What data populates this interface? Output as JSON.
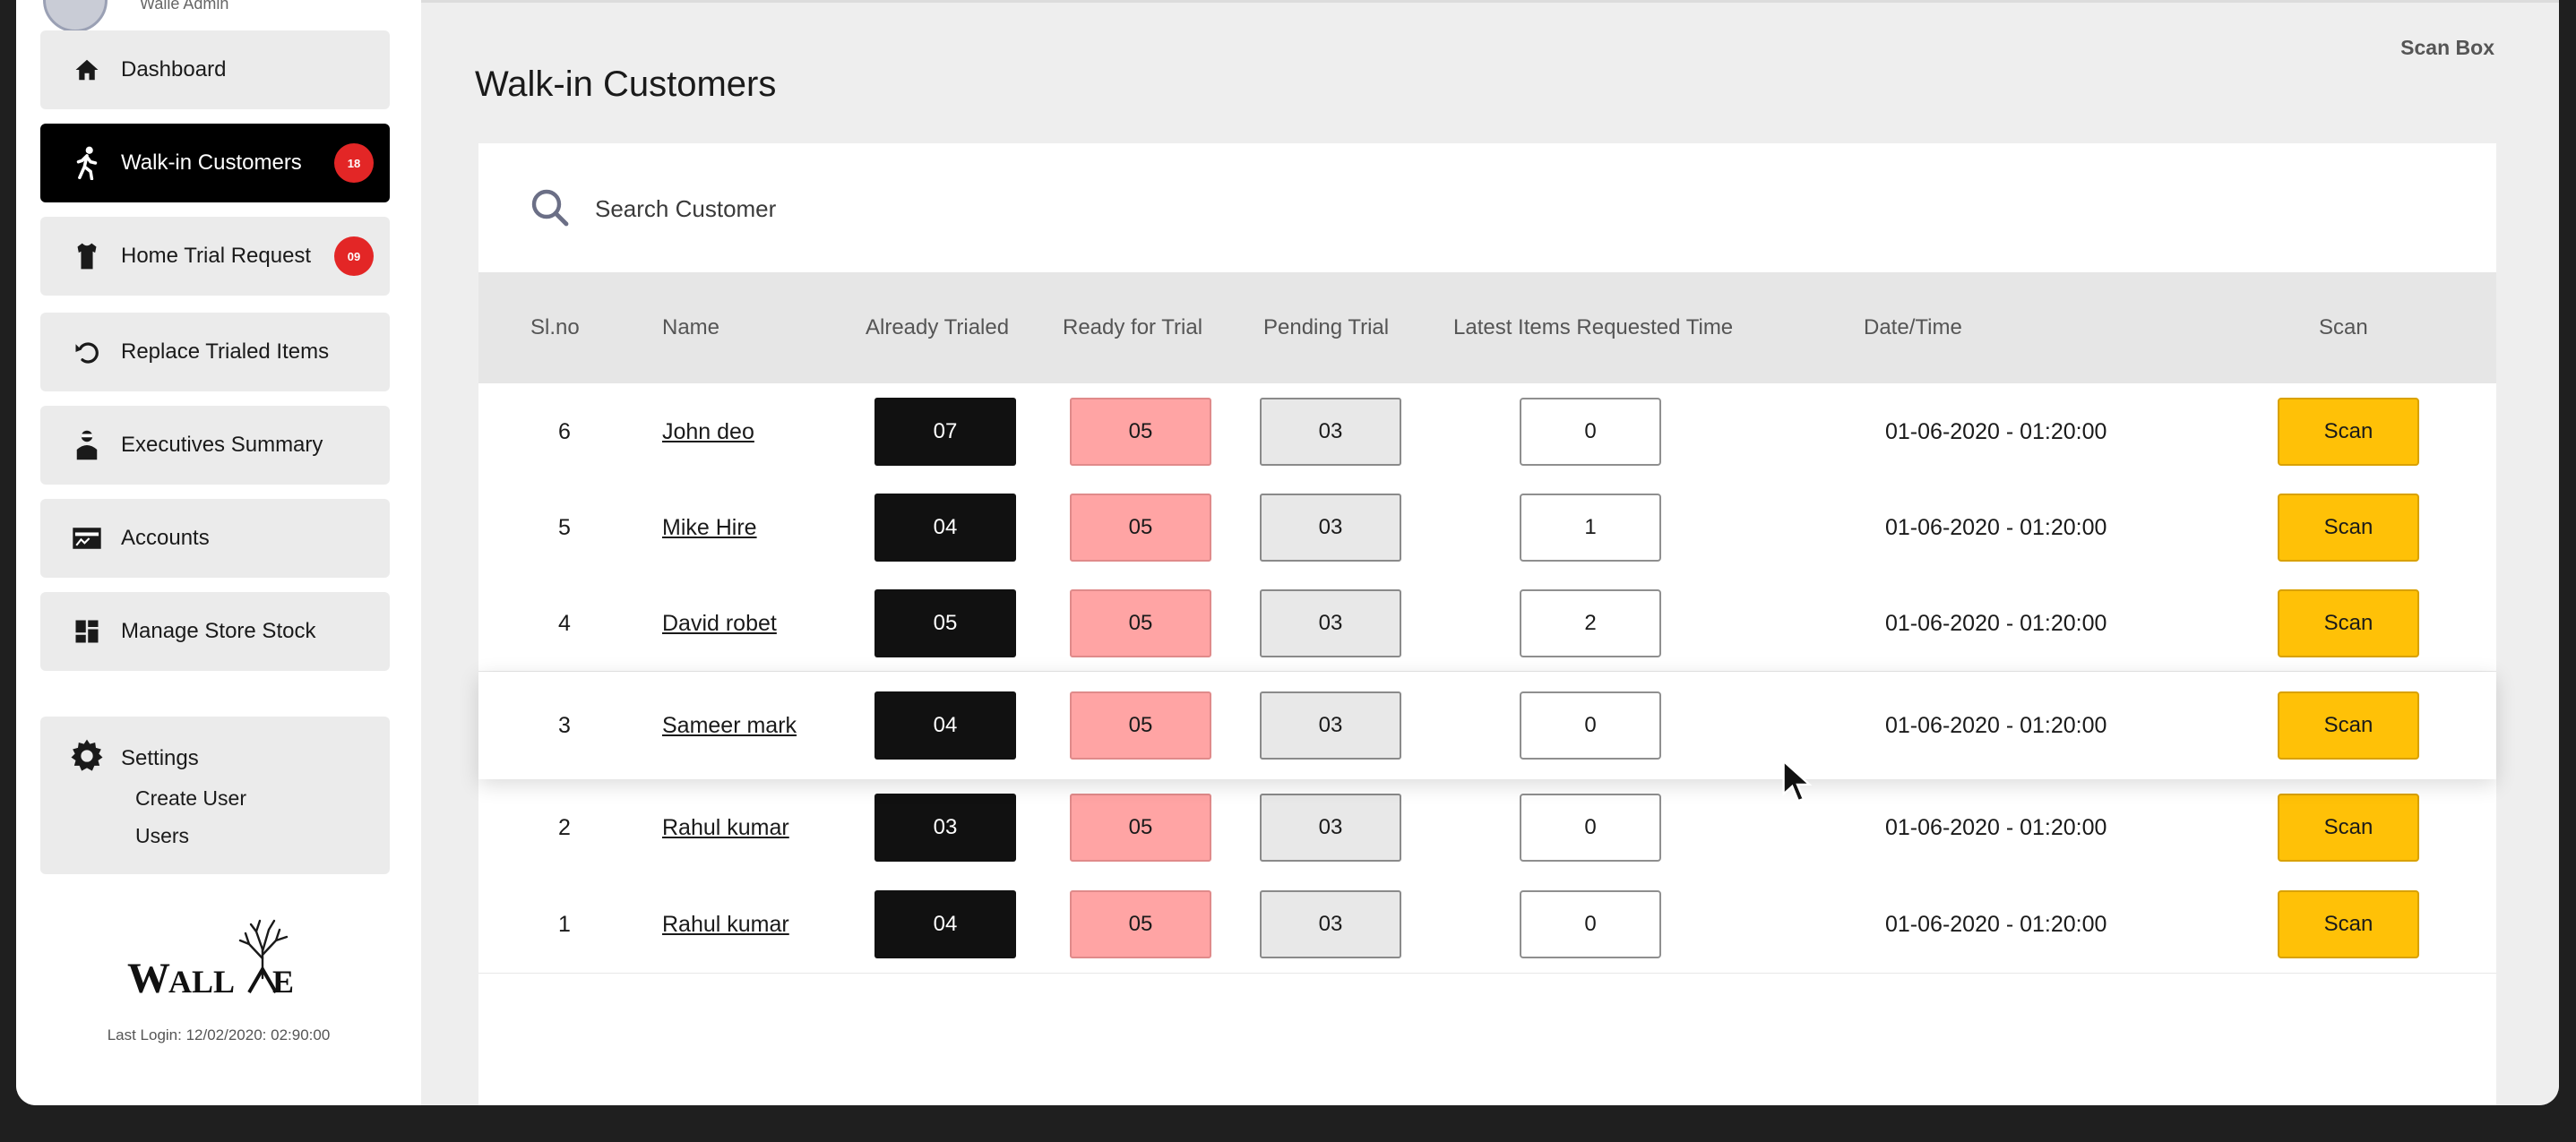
{
  "user": {
    "name": "Walle Admin"
  },
  "sidebar": {
    "items": [
      {
        "label": "Dashboard",
        "icon": "home-icon"
      },
      {
        "label": "Walk-in Customers",
        "icon": "walking-person-icon",
        "badge": "18",
        "active": true
      },
      {
        "label": "Home Trial Request",
        "icon": "shirt-icon",
        "badge": "09"
      },
      {
        "label": "Replace Trialed Items",
        "icon": "undo-icon"
      },
      {
        "label": "Executives Summary",
        "icon": "executive-icon"
      },
      {
        "label": "Accounts",
        "icon": "accounts-icon"
      },
      {
        "label": "Manage Store Stock",
        "icon": "stock-grid-icon"
      }
    ],
    "settings": {
      "label": "Settings",
      "icon": "gear-icon",
      "sub": [
        "Create User",
        "Users"
      ]
    },
    "logo_text": "WALLE",
    "last_login": "Last Login: 12/02/2020: 02:90:00"
  },
  "main": {
    "title": "Walk-in Customers",
    "scan_box_label": "Scan Box",
    "search": {
      "placeholder": "Search Customer",
      "value": ""
    },
    "table": {
      "headers": [
        "Sl.no",
        "Name",
        "Already Trialed",
        "Ready for Trial",
        "Pending Trial",
        "Latest Items Requested Time",
        "Date/Time",
        "Scan"
      ],
      "rows": [
        {
          "sl": "6",
          "name": "John deo ",
          "already": "07",
          "ready": "05",
          "pending": "03",
          "latest": "0",
          "datetime": "01-06-2020 - 01:20:00",
          "scan": "Scan"
        },
        {
          "sl": "5",
          "name": "Mike Hire",
          "already": "04",
          "ready": "05",
          "pending": "03",
          "latest": "1",
          "datetime": "01-06-2020 - 01:20:00",
          "scan": "Scan"
        },
        {
          "sl": "4",
          "name": "David robet",
          "already": "05",
          "ready": "05",
          "pending": "03",
          "latest": "2",
          "datetime": "01-06-2020 - 01:20:00",
          "scan": "Scan"
        },
        {
          "sl": "3",
          "name": "Sameer mark",
          "already": "04",
          "ready": "05",
          "pending": "03",
          "latest": "0",
          "datetime": "01-06-2020 - 01:20:00",
          "scan": "Scan"
        },
        {
          "sl": "2",
          "name": "Rahul kumar",
          "already": "03",
          "ready": "05",
          "pending": "03",
          "latest": "0",
          "datetime": "01-06-2020 - 01:20:00",
          "scan": "Scan"
        },
        {
          "sl": "1",
          "name": "Rahul kumar",
          "already": "04",
          "ready": "05",
          "pending": "03",
          "latest": "0",
          "datetime": "01-06-2020 - 01:20:00",
          "scan": "Scan"
        }
      ]
    }
  },
  "colors": {
    "accent": "#ffc107",
    "badge": "#e32626",
    "active_nav": "#000000",
    "ready_chip": "#ffa4a4"
  }
}
